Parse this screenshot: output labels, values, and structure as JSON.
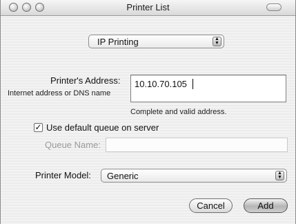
{
  "window": {
    "title": "Printer List"
  },
  "protocol_popup": {
    "selected": "IP Printing"
  },
  "address": {
    "label": "Printer's Address:",
    "sublabel": "Internet address or DNS name",
    "value": "10.10.70.105",
    "status": "Complete and valid address."
  },
  "queue": {
    "checkbox_label": "Use default queue on server",
    "checked": true,
    "checkmark": "✓",
    "name_label": "Queue Name:",
    "name_value": ""
  },
  "model": {
    "label": "Printer Model:",
    "selected": "Generic"
  },
  "buttons": {
    "cancel": "Cancel",
    "add": "Add"
  },
  "icons": {
    "popup_arrows": "⬍"
  }
}
